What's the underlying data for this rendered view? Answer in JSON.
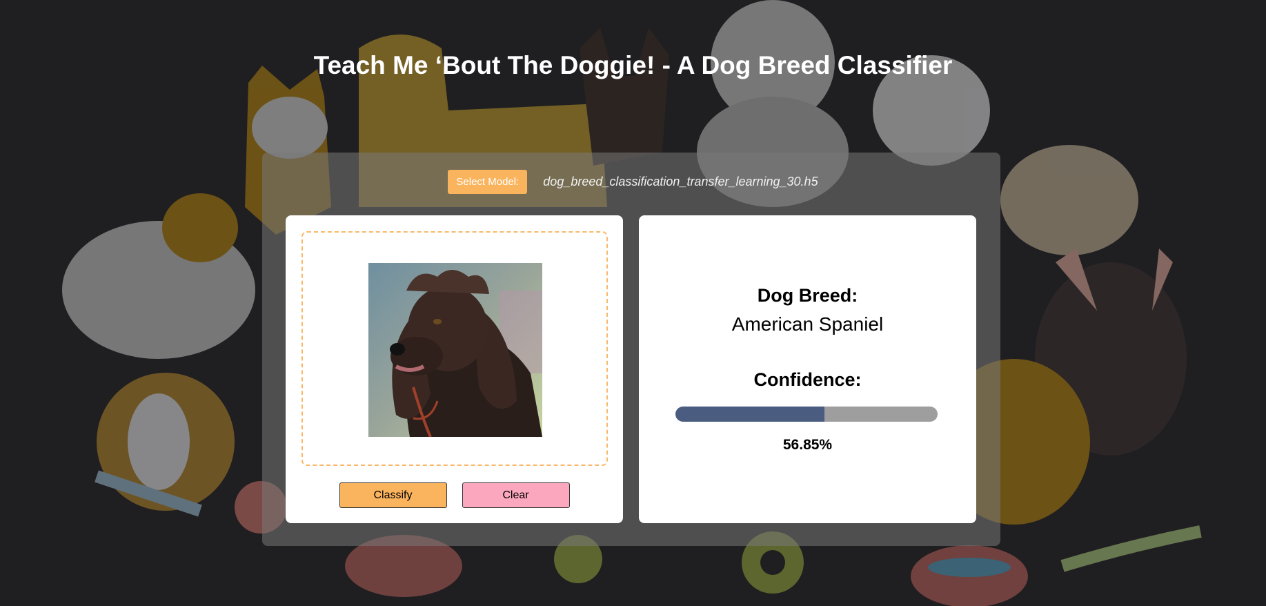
{
  "page": {
    "title": "Teach Me ‘Bout The Doggie! - A Dog Breed Classifier"
  },
  "model": {
    "select_label": "Select Model:",
    "selected_file": "dog_breed_classification_transfer_learning_30.h5"
  },
  "upload": {
    "image_icon": "dog-photo",
    "classify_label": "Classify",
    "clear_label": "Clear"
  },
  "result": {
    "breed_heading": "Dog Breed:",
    "breed_value": "American Spaniel",
    "confidence_heading": "Confidence:",
    "confidence_fraction": 0.5685,
    "confidence_text": "56.85%"
  },
  "colors": {
    "background": "#1f1e21",
    "accent_orange": "#fbb45e",
    "accent_pink": "#fba7bd",
    "progress_fill": "#4a5c80",
    "progress_track": "#9e9e9e"
  }
}
